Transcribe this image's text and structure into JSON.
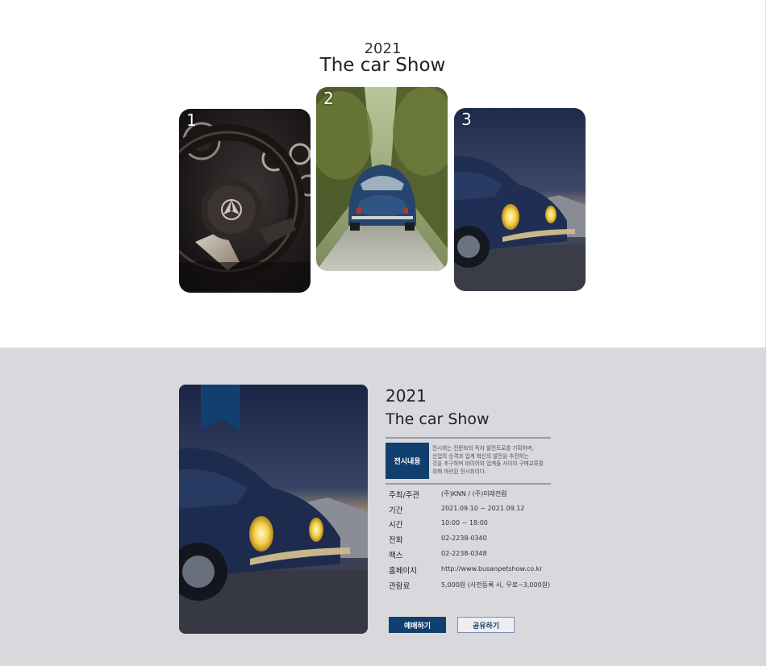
{
  "hero": {
    "year": "2021",
    "title": "The car Show",
    "cards": [
      {
        "number": "1",
        "image": "steering-wheel-photo"
      },
      {
        "number": "2",
        "image": "blue-beetle-forest-road-photo"
      },
      {
        "number": "3",
        "image": "blue-beetle-headlights-photo"
      }
    ]
  },
  "detail": {
    "poster_image": "blue-beetle-headlights-photo",
    "year": "2021",
    "title": "The car Show",
    "badge": "전시내용",
    "description": [
      "전시회는 전문화의 독자 발전토로를 기획하며,",
      "산업의 승격과 업계 혁신의 발전을 추진하는",
      "것을 추구하며 바이어와 업계들 사이의 구매교류를",
      "위해 마련된 전시회이다."
    ],
    "info": [
      {
        "label": "주최/주관",
        "value": "(주)KNN / (주)미래전람"
      },
      {
        "label": "기간",
        "value": "2021.09.10 ~ 2021.09.12"
      },
      {
        "label": "시간",
        "value": "10:00 ~ 18:00"
      },
      {
        "label": "전화",
        "value": "02-2238-0340"
      },
      {
        "label": "팩스",
        "value": "02-2238-0348"
      },
      {
        "label": "홈페이지",
        "value": "http://www.busanpetshow.co.kr"
      },
      {
        "label": "관람료",
        "value": "5,000원 (사전등록 시, 무료~3,000원)"
      }
    ],
    "buttons": {
      "book": "예매하기",
      "share": "공유하기"
    }
  },
  "colors": {
    "accent": "#12406e",
    "section_bg": "#d9d8dd"
  }
}
